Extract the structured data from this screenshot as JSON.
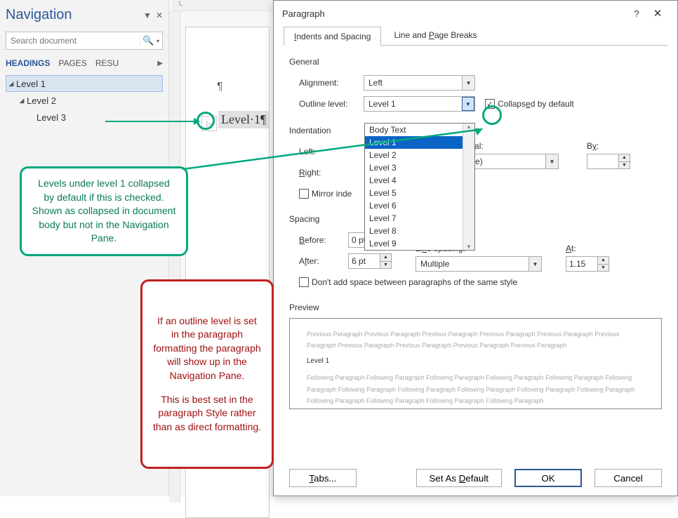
{
  "navigation": {
    "title": "Navigation",
    "search_placeholder": "Search document",
    "tabs": {
      "headings": "HEADINGS",
      "pages": "PAGES",
      "results": "RESU"
    },
    "items": [
      {
        "label": "Level 1"
      },
      {
        "label": "Level 2"
      },
      {
        "label": "Level 3"
      }
    ]
  },
  "document": {
    "heading_text": "Level·1¶",
    "pilcrow": "¶",
    "ruler_mark": "L"
  },
  "dialog": {
    "title": "Paragraph",
    "tabs": {
      "indents": "Indents and Spacing",
      "breaks": "Line and Page Breaks"
    },
    "sections": {
      "general": "General",
      "indentation": "Indentation",
      "spacing": "Spacing",
      "preview": "Preview"
    },
    "labels": {
      "alignment": "Alignment:",
      "outline": "Outline level:",
      "collapsed": "Collapsed by default",
      "left": "Left:",
      "right": "Right:",
      "special": "Special:",
      "by": "By:",
      "mirror": "Mirror inde",
      "before": "Before:",
      "after": "After:",
      "line_spacing": "Line spacing:",
      "at": "At:",
      "no_space": "Don't add space between paragraphs of the same style",
      "underline_p": "P",
      "underline_i": "I"
    },
    "values": {
      "alignment": "Left",
      "outline": "Level 1",
      "special": "(none)",
      "before": "0 pt",
      "after": "6 pt",
      "line_spacing": "Multiple",
      "at": "1.15"
    },
    "outline_options": [
      "Body Text",
      "Level 1",
      "Level 2",
      "Level 3",
      "Level 4",
      "Level 5",
      "Level 6",
      "Level 7",
      "Level 8",
      "Level 9"
    ],
    "collapsed_checked": "✓",
    "preview": {
      "prev": "Previous Paragraph Previous Paragraph Previous Paragraph Previous Paragraph Previous Paragraph Previous Paragraph Previous Paragraph Previous Paragraph Previous Paragraph Previous Paragraph",
      "sample": "Level 1",
      "next": "Following Paragraph Following Paragraph Following Paragraph Following Paragraph Following Paragraph Following Paragraph Following Paragraph Following Paragraph Following Paragraph Following Paragraph Following Paragraph Following Paragraph Following Paragraph Following Paragraph Following Paragraph"
    },
    "buttons": {
      "tabs": "Tabs...",
      "default": "Set As Default",
      "ok": "OK",
      "cancel": "Cancel"
    }
  },
  "annotations": {
    "green": "Levels under level 1 collapsed by default if this is checked. Shown as collapsed in document body but not in the Navigation Pane.",
    "red1": "If an outline level is set in the paragraph formatting the paragraph will show up in the Navigation Pane.",
    "red2": "This is best set in the paragraph Style rather than as direct formatting."
  }
}
